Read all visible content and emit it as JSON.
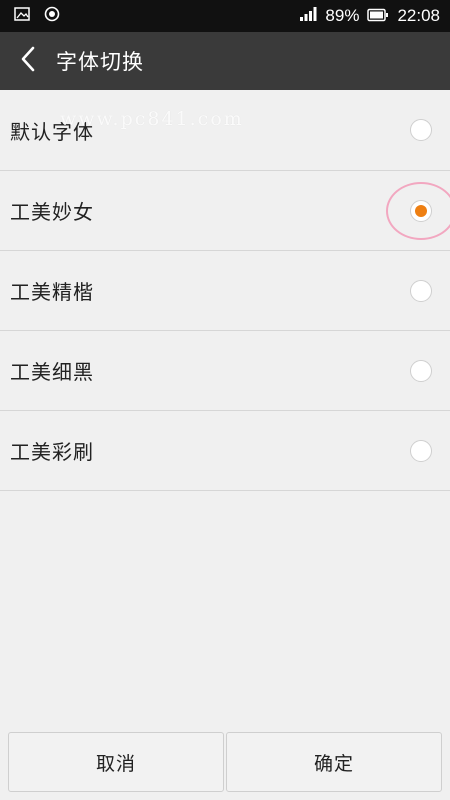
{
  "status_bar": {
    "left_icons": [
      "image-icon",
      "record-icon"
    ],
    "signal_icon": "signal-bars-icon",
    "battery_percent": "89%",
    "battery_icon": "battery-icon",
    "time": "22:08"
  },
  "app_bar": {
    "back_icon": "chevron-left-icon",
    "title": "字体切换"
  },
  "fonts": {
    "items": [
      {
        "label": "默认字体",
        "selected": false
      },
      {
        "label": "工美妙女",
        "selected": true
      },
      {
        "label": "工美精楷",
        "selected": false
      },
      {
        "label": "工美细黑",
        "selected": false
      },
      {
        "label": "工美彩刷",
        "selected": false
      }
    ]
  },
  "watermark": "www.pc841.com",
  "buttons": {
    "cancel": "取消",
    "confirm": "确定"
  },
  "colors": {
    "status_bar_bg": "#111111",
    "app_bar_bg": "#3a3a3a",
    "page_bg": "#f0f0f0",
    "accent_radio": "#ee7f12",
    "annotation_ring": "#f2a7c0"
  }
}
